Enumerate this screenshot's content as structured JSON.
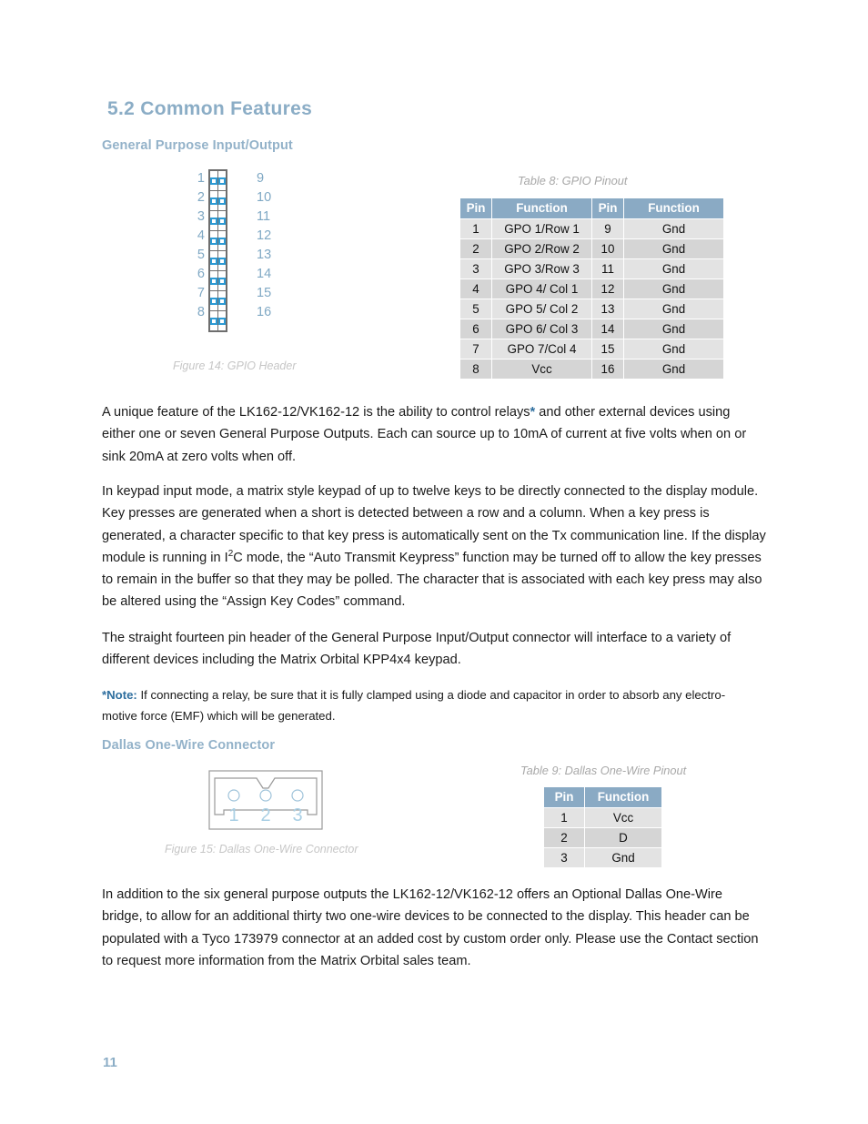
{
  "document": {
    "section_number_title": "5.2 Common Features",
    "page_number": "11"
  },
  "gpio_section": {
    "heading": "General Purpose Input/Output",
    "figure": {
      "caption": "Figure 14: GPIO Header",
      "left_pins": [
        "1",
        "2",
        "3",
        "4",
        "5",
        "6",
        "7",
        "8"
      ],
      "right_pins": [
        "9",
        "10",
        "11",
        "12",
        "13",
        "14",
        "15",
        "16"
      ]
    },
    "table": {
      "caption": "Table 8: GPIO Pinout",
      "headers": [
        "Pin",
        "Function",
        "Pin",
        "Function"
      ],
      "rows": [
        [
          "1",
          "GPO 1/Row 1",
          "9",
          "Gnd"
        ],
        [
          "2",
          "GPO 2/Row 2",
          "10",
          "Gnd"
        ],
        [
          "3",
          "GPO 3/Row 3",
          "11",
          "Gnd"
        ],
        [
          "4",
          "GPO 4/ Col 1",
          "12",
          "Gnd"
        ],
        [
          "5",
          "GPO 5/ Col 2",
          "13",
          "Gnd"
        ],
        [
          "6",
          "GPO 6/ Col 3",
          "14",
          "Gnd"
        ],
        [
          "7",
          "GPO 7/Col 4",
          "15",
          "Gnd"
        ],
        [
          "8",
          "Vcc",
          "16",
          "Gnd"
        ]
      ]
    },
    "paragraph_1_a": "A unique feature of the LK162-12/VK162-12 is the ability to control relays",
    "paragraph_1_ast": "*",
    "paragraph_1_b": " and other external devices using either one or seven General Purpose Outputs.  Each can source up to 10mA of current at five volts when on or sink 20mA at zero volts when off.",
    "paragraph_2_a": "In keypad input mode, a matrix style keypad of up to twelve keys to be directly connected to the display module.  Key presses are generated when a short is detected between a row and a column.  When a key press is generated, a character specific to that key press is automatically sent on the Tx communication line.  If the display module is running in I",
    "paragraph_2_sup": "2",
    "paragraph_2_b": "C mode, the “Auto Transmit Keypress” function may be turned off to allow the key presses to remain in the buffer so that they may be polled.  The character that is associated with each key press may also be altered using the “Assign Key Codes” command.",
    "paragraph_3": "The straight fourteen pin header of the General Purpose Input/Output connector will interface to a variety of different devices including the Matrix Orbital KPP4x4 keypad.",
    "note_label": "*Note:",
    "note_text": " If connecting a relay, be sure that it is fully clamped using a diode and capacitor in order to absorb any electro-motive force (EMF) which will be generated."
  },
  "dallas_section": {
    "heading": "Dallas One-Wire Connector",
    "figure": {
      "caption": "Figure 15: Dallas One-Wire Connector",
      "pin_labels": [
        "1",
        "2",
        "3"
      ]
    },
    "table": {
      "caption": "Table 9: Dallas One-Wire Pinout",
      "headers": [
        "Pin",
        "Function"
      ],
      "rows": [
        [
          "1",
          "Vcc"
        ],
        [
          "2",
          "D"
        ],
        [
          "3",
          "Gnd"
        ]
      ]
    },
    "paragraph": "In addition to the six general purpose outputs the LK162-12/VK162-12 offers an Optional Dallas One-Wire bridge, to allow for an additional thirty two one-wire devices to be connected to the display.  This header can be populated with a Tyco 173979 connector at an added cost by custom order only.  Please use the Contact section to request more information from the Matrix Orbital sales team."
  },
  "colors": {
    "heading_blue": "#8badc6",
    "table_header_blue": "#8aaac4",
    "accent_blue": "#2f6f9f",
    "pin_square_blue": "#2c9ad4",
    "caption_gray": "#a8a8a8"
  }
}
